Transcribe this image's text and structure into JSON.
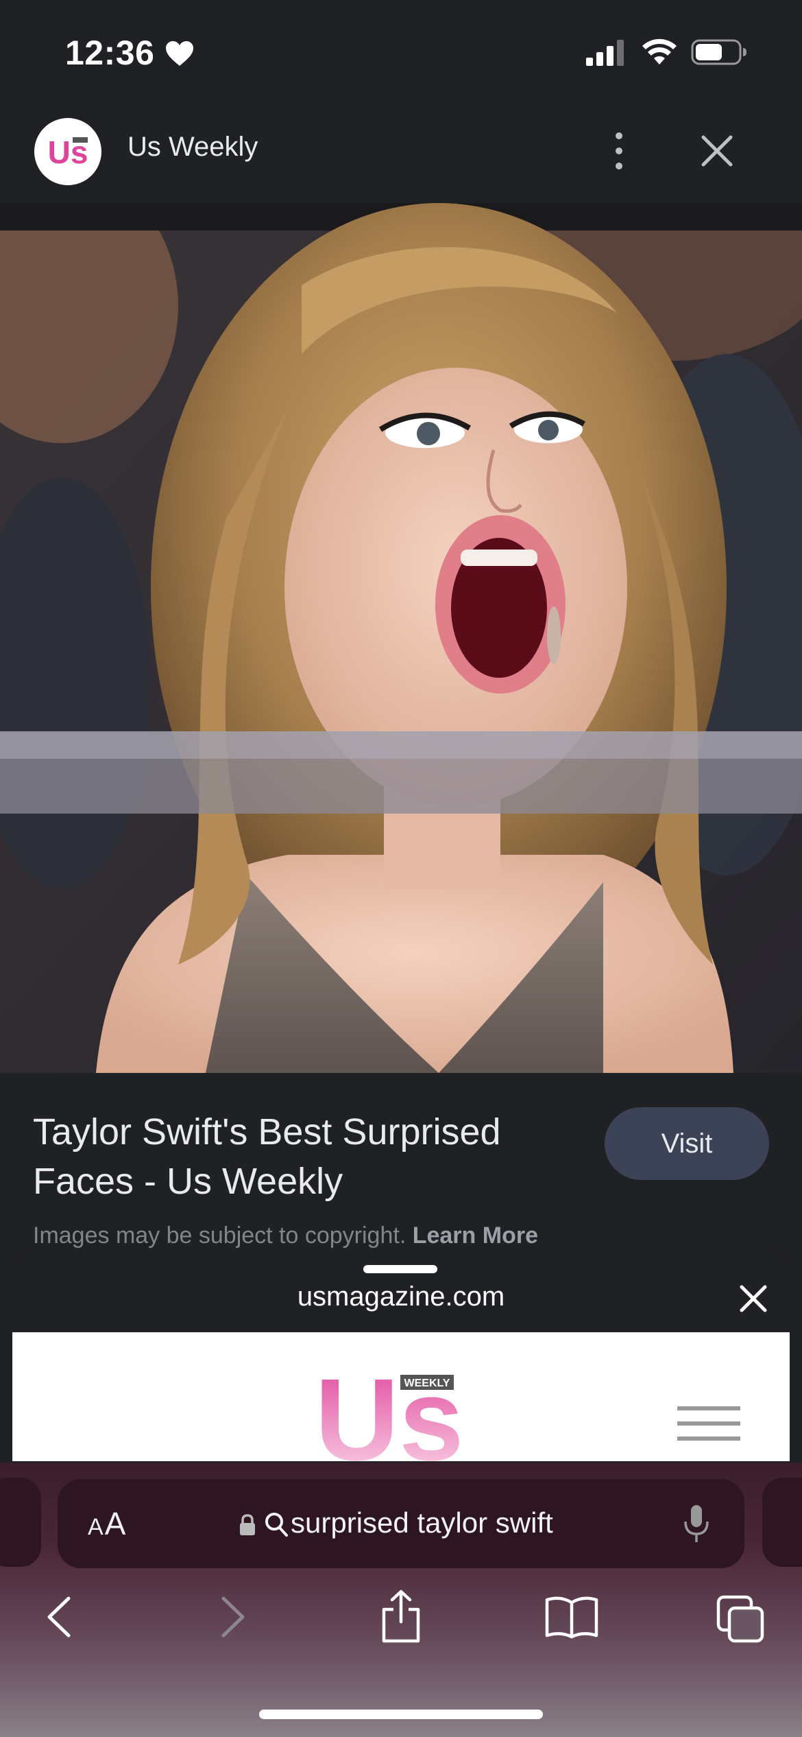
{
  "status_bar": {
    "time": "12:36"
  },
  "source_header": {
    "logo_text": "Us",
    "site_name": "Us Weekly"
  },
  "result": {
    "title": "Taylor Swift's Best Surprised Faces - Us Weekly",
    "visit_label": "Visit",
    "copyright_text": "Images may be subject to copyright.",
    "learn_more_label": "Learn More"
  },
  "sheet": {
    "domain": "usmagazine.com",
    "logo_text": "Us",
    "logo_badge": "WEEKLY"
  },
  "safari": {
    "aa_small": "A",
    "aa_large": "A",
    "address_text": "surprised taylor swift"
  },
  "colors": {
    "background": "#202124",
    "visit_button": "#3c4357",
    "brand_pink": "#e0439a",
    "safari_bar": "#3a1e2c"
  }
}
